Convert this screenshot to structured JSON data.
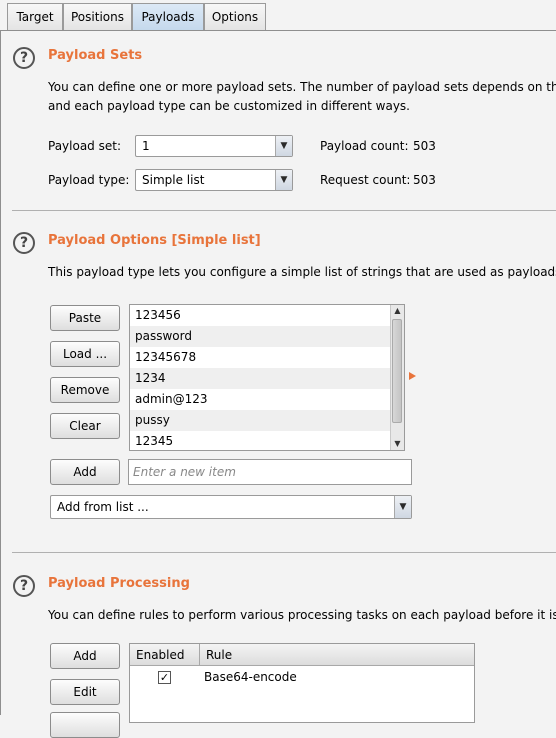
{
  "tabs": [
    {
      "label": "Target"
    },
    {
      "label": "Positions"
    },
    {
      "label": "Payloads"
    },
    {
      "label": "Options"
    }
  ],
  "payload_sets": {
    "help": "?",
    "title": "Payload Sets",
    "desc1": "You can define one or more payload sets. The number of payload sets depends on the a",
    "desc2": "and each payload type can be customized in different ways.",
    "set_label": "Payload set:",
    "set_value": "1",
    "type_label": "Payload type:",
    "type_value": "Simple list",
    "count_label": "Payload count:",
    "count_value": "503",
    "request_label": "Request count:",
    "request_value": "503"
  },
  "payload_options": {
    "help": "?",
    "title": "Payload Options [Simple list]",
    "desc": "This payload type lets you configure a simple list of strings that are used as payloads.",
    "paste": "Paste",
    "load": "Load ...",
    "remove": "Remove",
    "clear": "Clear",
    "items": [
      "123456",
      "password",
      "12345678",
      "1234",
      "admin@123",
      "pussy",
      "12345"
    ],
    "add": "Add",
    "add_placeholder": "Enter a new item",
    "add_from_list": "Add from list ..."
  },
  "payload_processing": {
    "help": "?",
    "title": "Payload Processing",
    "desc": "You can define rules to perform various processing tasks on each payload before it is us",
    "add": "Add",
    "edit": "Edit",
    "col_enabled": "Enabled",
    "col_rule": "Rule",
    "rules": [
      {
        "enabled": "✓",
        "rule": "Base64-encode"
      }
    ]
  }
}
